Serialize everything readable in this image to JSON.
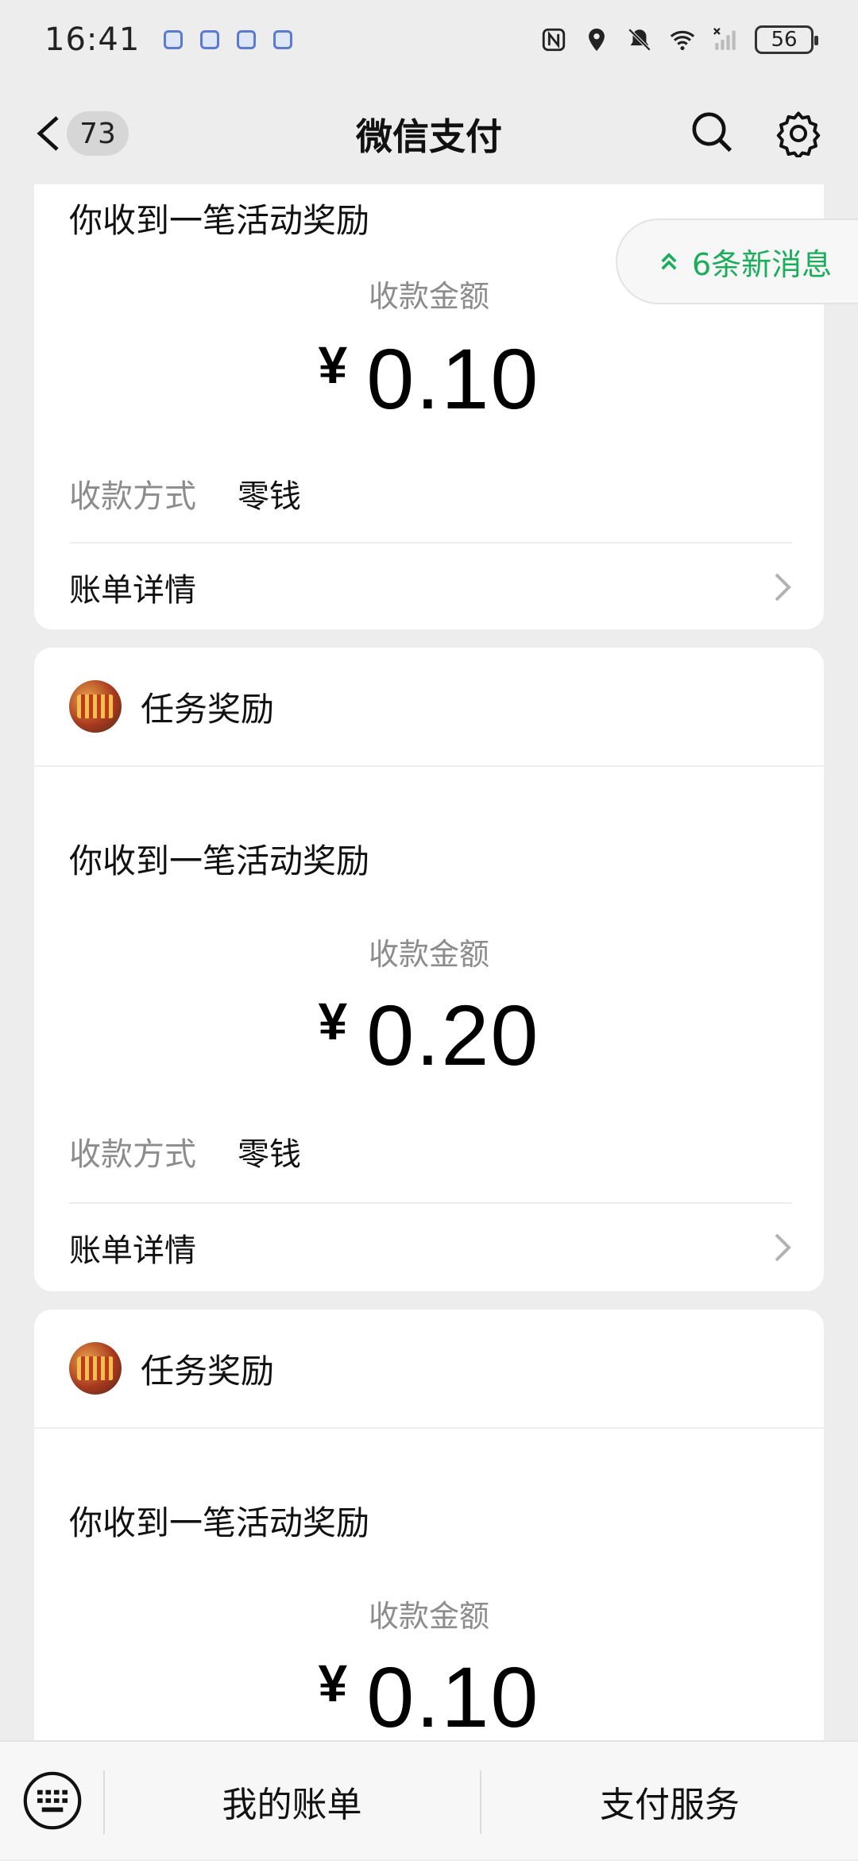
{
  "status_bar": {
    "time": "16:41",
    "battery": "56",
    "notification_icons": [
      "app-notification-icon",
      "app-notification-icon",
      "app-notification-icon",
      "app-notification-icon"
    ],
    "right_icons": [
      "nfc-icon",
      "location-icon",
      "mute-icon",
      "wifi-icon",
      "signal-icon"
    ]
  },
  "nav": {
    "title": "微信支付",
    "unread_count": "73"
  },
  "new_messages": "6条新消息",
  "cards": [
    {
      "message_title": "你收到一笔活动奖励",
      "amount_label": "收款金额",
      "currency": "¥",
      "amount": "0.10",
      "method_label": "收款方式",
      "method_value": "零钱",
      "detail_label": "账单详情"
    },
    {
      "sender": "任务奖励",
      "message_title": "你收到一笔活动奖励",
      "amount_label": "收款金额",
      "currency": "¥",
      "amount": "0.20",
      "method_label": "收款方式",
      "method_value": "零钱",
      "detail_label": "账单详情"
    },
    {
      "sender": "任务奖励",
      "message_title": "你收到一笔活动奖励",
      "amount_label": "收款金额",
      "currency": "¥",
      "amount": "0.10"
    }
  ],
  "bottom_bar": {
    "item1": "我的账单",
    "item2": "支付服务"
  },
  "colors": {
    "background": "#ededed",
    "accent_green": "#1aad5a",
    "card": "#ffffff",
    "secondary_text": "#8c8c8c"
  }
}
